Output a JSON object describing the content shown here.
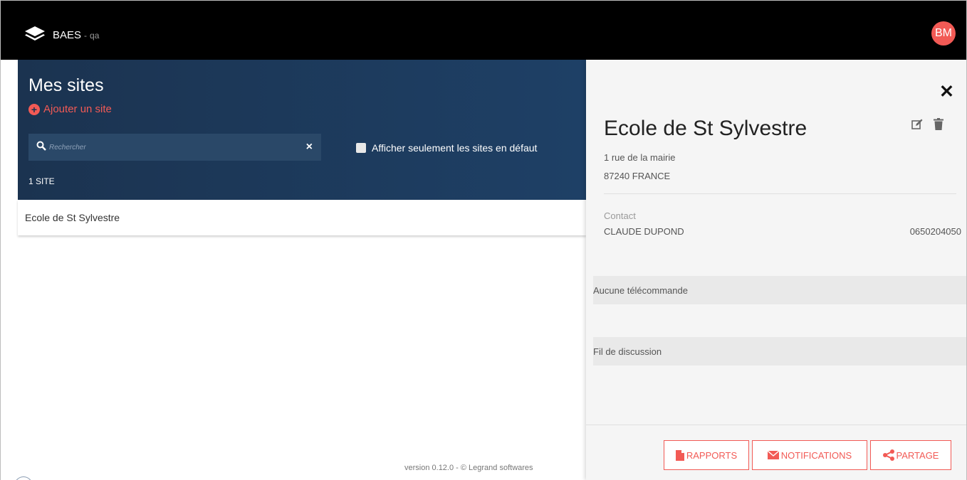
{
  "app": {
    "name": "BAES",
    "env_separator": "-",
    "env": "qa",
    "avatar_initials": "BM"
  },
  "sites": {
    "title": "Mes sites",
    "add_label": "Ajouter un site",
    "search_placeholder": "Rechercher",
    "filter_label": "Afficher seulement les sites en défaut",
    "count_label": "1 SITE",
    "items": [
      {
        "name": "Ecole de St Sylvestre"
      }
    ]
  },
  "footer": {
    "version": "version 0.12.0 - © Legrand softwares"
  },
  "detail": {
    "title": "Ecole de St Sylvestre",
    "address_line1": "1 rue de la mairie",
    "address_line2": "87240 FRANCE",
    "contact_label": "Contact",
    "contact_name": "CLAUDE DUPOND",
    "contact_phone": "0650204050",
    "remotes_label": "Aucune télécommande",
    "discussion_label": "Fil de discussion",
    "buttons": {
      "reports": "RAPPORTS",
      "notifications": "NOTIFICATIONS",
      "share": "PARTAGE"
    }
  },
  "colors": {
    "accent": "#f25a55",
    "header_bg": "#1b3350",
    "topbar_bg": "#000000"
  }
}
